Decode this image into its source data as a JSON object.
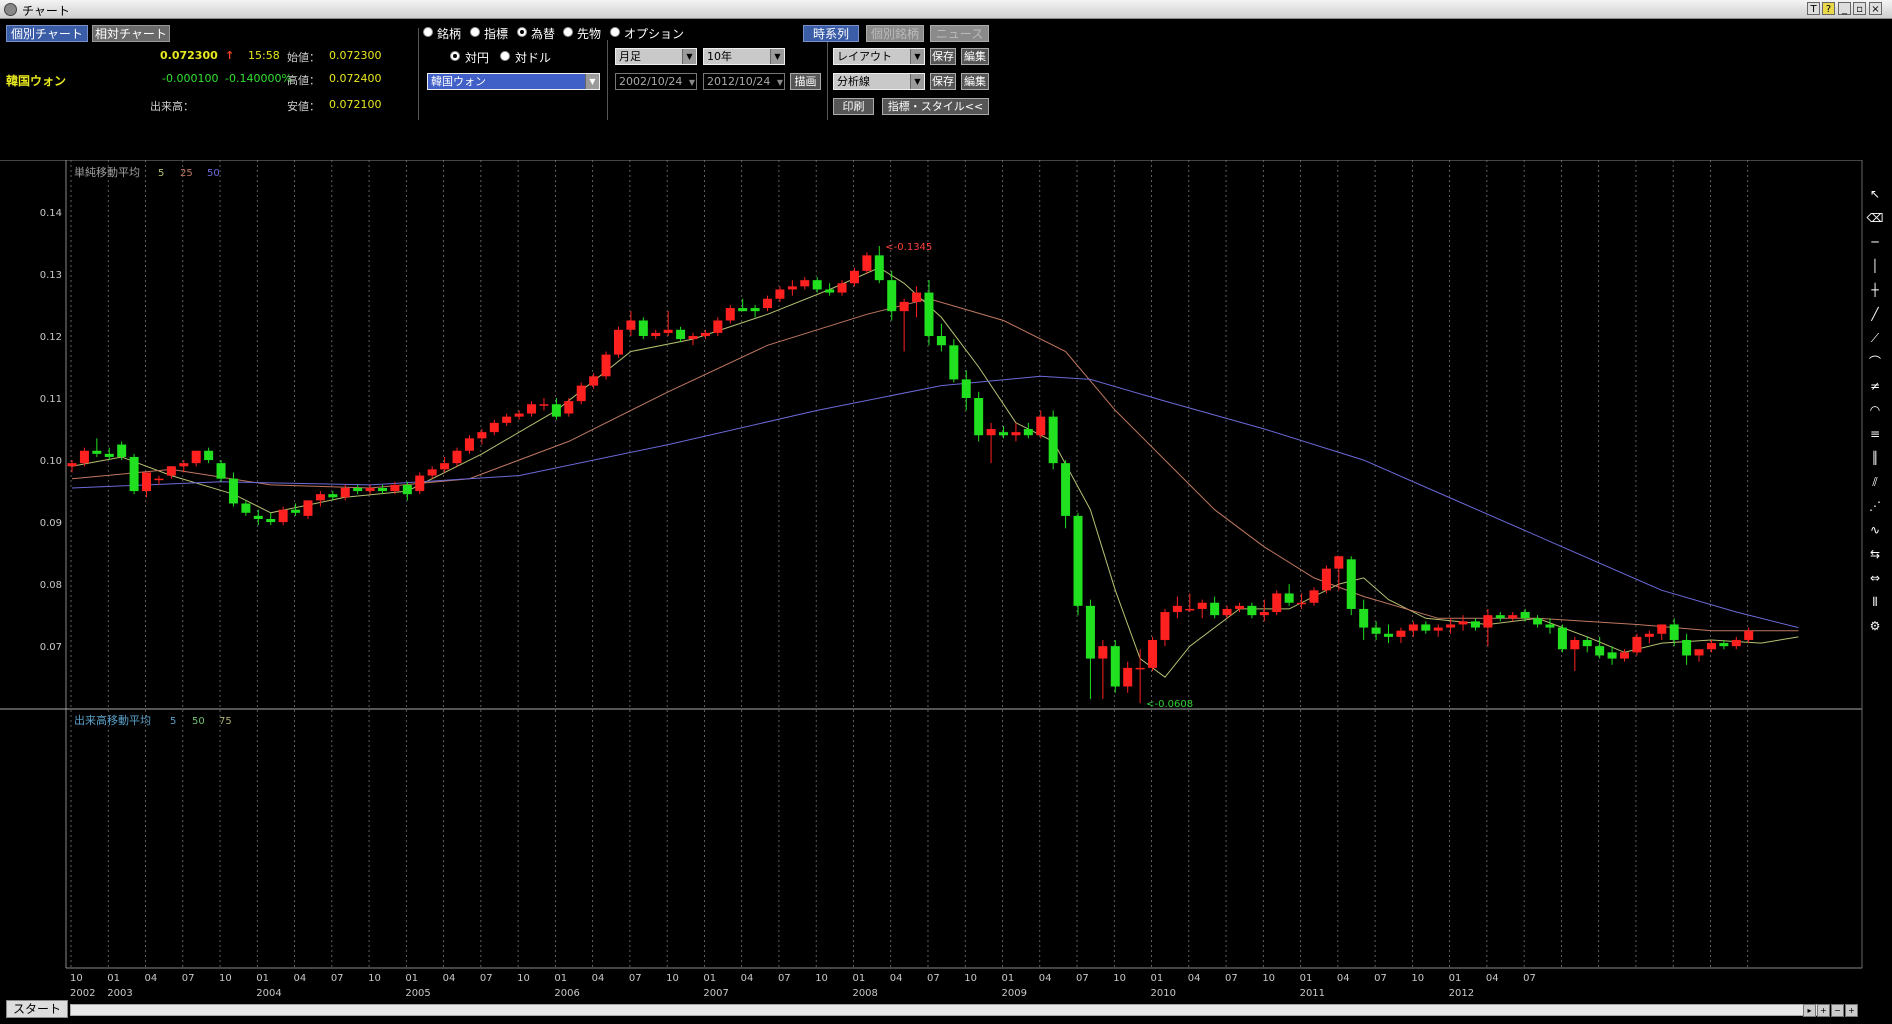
{
  "window": {
    "title": "チャート"
  },
  "tabs": {
    "individual": "個別チャート",
    "relative": "相対チャート"
  },
  "quote": {
    "name": "韓国ウォン",
    "price": "0.072300",
    "arrow": "↑",
    "time": "15:58",
    "change": "-0.000100",
    "change_pct": "-0.140000%",
    "volume_label": "出来高：",
    "open_label": "始値：",
    "open": "0.072300",
    "high_label": "高値：",
    "high": "0.072400",
    "low_label": "安値：",
    "low": "0.072100"
  },
  "asset_types": [
    "銘柄",
    "指標",
    "為替",
    "先物",
    "オプション"
  ],
  "asset_type_selected": 2,
  "fx_base": {
    "yen": "対円",
    "dollar": "対ドル",
    "selected": 0
  },
  "symbol_select": "韓国ウォン",
  "period": {
    "interval": "月足",
    "range": "10年",
    "start": "2002/10/24",
    "end": "2012/10/24",
    "draw": "描画"
  },
  "toolbar": {
    "timeseries": "時系列",
    "individual_stock": "個別銘柄",
    "news": "ニュース",
    "layout": "レイアウト",
    "analysis": "分析線",
    "save": "保存",
    "edit": "編集",
    "print": "印刷",
    "indicator_style": "指標・スタイル<<"
  },
  "price_panel": {
    "legend_title": "単純移動平均",
    "ma_periods": [
      "5",
      "25",
      "50"
    ],
    "ma_colors": [
      "#b8c070",
      "#c07860",
      "#6a6ad8"
    ]
  },
  "volume_panel": {
    "legend_title": "出来高移動平均",
    "ma_periods": [
      "5",
      "50",
      "75"
    ],
    "ma_colors": [
      "#5aa0c8",
      "#70c070",
      "#b0b070"
    ]
  },
  "colors": {
    "up": "#ff2020",
    "down": "#20e020",
    "background": "#000000",
    "grid": "#777777"
  },
  "chart_data": {
    "type": "candlestick",
    "interval": "monthly",
    "y_ticks": [
      "0.14",
      "0.13",
      "0.12",
      "0.11",
      "0.10",
      "0.09",
      "0.08",
      "0.07"
    ],
    "ylim": [
      0.061,
      0.1445
    ],
    "annotations": {
      "high": "<-0.1345",
      "low": "<-0.0608",
      "high_value": 0.1345,
      "low_value": 0.0608
    },
    "x_month_labels": [
      "10",
      "01",
      "04",
      "07",
      "10",
      "01",
      "04",
      "07",
      "10",
      "01",
      "04",
      "07",
      "10",
      "01",
      "04",
      "07",
      "10",
      "01",
      "04",
      "07",
      "10",
      "01",
      "04",
      "07",
      "10",
      "01",
      "04",
      "07",
      "10",
      "01",
      "04",
      "07",
      "10",
      "01",
      "04",
      "07",
      "10",
      "01",
      "04",
      "07"
    ],
    "x_year_labels": [
      "2002",
      "2003",
      "2004",
      "2005",
      "2006",
      "2007",
      "2008",
      "2009",
      "2010",
      "2011",
      "2012"
    ],
    "candles": [
      [
        0.099,
        0.1,
        0.098,
        0.0995
      ],
      [
        0.0995,
        0.102,
        0.099,
        0.1015
      ],
      [
        0.1015,
        0.1035,
        0.1005,
        0.101
      ],
      [
        0.101,
        0.102,
        0.1,
        0.1005
      ],
      [
        0.1025,
        0.103,
        0.1,
        0.1005
      ],
      [
        0.1005,
        0.101,
        0.0945,
        0.095
      ],
      [
        0.095,
        0.098,
        0.094,
        0.098
      ],
      [
        0.097,
        0.0975,
        0.096,
        0.097
      ],
      [
        0.0975,
        0.099,
        0.097,
        0.099
      ],
      [
        0.099,
        0.1,
        0.098,
        0.0995
      ],
      [
        0.0995,
        0.1015,
        0.099,
        0.1015
      ],
      [
        0.1015,
        0.102,
        0.0995,
        0.1
      ],
      [
        0.0995,
        0.1,
        0.0965,
        0.097
      ],
      [
        0.097,
        0.098,
        0.0925,
        0.093
      ],
      [
        0.093,
        0.0935,
        0.091,
        0.0915
      ],
      [
        0.091,
        0.092,
        0.0895,
        0.0905
      ],
      [
        0.0905,
        0.0915,
        0.0895,
        0.09
      ],
      [
        0.09,
        0.0925,
        0.0895,
        0.092
      ],
      [
        0.092,
        0.093,
        0.091,
        0.0915
      ],
      [
        0.091,
        0.0935,
        0.0905,
        0.0935
      ],
      [
        0.0935,
        0.095,
        0.0925,
        0.0945
      ],
      [
        0.0945,
        0.095,
        0.0935,
        0.094
      ],
      [
        0.094,
        0.096,
        0.0935,
        0.0955
      ],
      [
        0.0955,
        0.096,
        0.0945,
        0.095
      ],
      [
        0.095,
        0.096,
        0.0945,
        0.0955
      ],
      [
        0.0955,
        0.096,
        0.0945,
        0.095
      ],
      [
        0.095,
        0.0965,
        0.0945,
        0.096
      ],
      [
        0.096,
        0.0965,
        0.0935,
        0.0945
      ],
      [
        0.095,
        0.098,
        0.0945,
        0.0975
      ],
      [
        0.0975,
        0.099,
        0.097,
        0.0985
      ],
      [
        0.0985,
        0.1005,
        0.098,
        0.0995
      ],
      [
        0.0995,
        0.102,
        0.099,
        0.1015
      ],
      [
        0.1015,
        0.104,
        0.101,
        0.1035
      ],
      [
        0.1035,
        0.105,
        0.1025,
        0.1045
      ],
      [
        0.1045,
        0.1065,
        0.104,
        0.106
      ],
      [
        0.106,
        0.1075,
        0.1055,
        0.107
      ],
      [
        0.107,
        0.108,
        0.1065,
        0.1075
      ],
      [
        0.1075,
        0.1095,
        0.107,
        0.109
      ],
      [
        0.109,
        0.11,
        0.108,
        0.109
      ],
      [
        0.109,
        0.11,
        0.1065,
        0.107
      ],
      [
        0.1075,
        0.11,
        0.107,
        0.1095
      ],
      [
        0.1095,
        0.1125,
        0.109,
        0.112
      ],
      [
        0.112,
        0.114,
        0.1115,
        0.1135
      ],
      [
        0.1135,
        0.1175,
        0.113,
        0.117
      ],
      [
        0.117,
        0.1215,
        0.1165,
        0.121
      ],
      [
        0.121,
        0.124,
        0.12,
        0.1225
      ],
      [
        0.1225,
        0.123,
        0.1195,
        0.12
      ],
      [
        0.12,
        0.121,
        0.1195,
        0.1205
      ],
      [
        0.1205,
        0.124,
        0.12,
        0.121
      ],
      [
        0.121,
        0.1215,
        0.119,
        0.1195
      ],
      [
        0.1195,
        0.1205,
        0.1185,
        0.12
      ],
      [
        0.12,
        0.121,
        0.1195,
        0.1205
      ],
      [
        0.1205,
        0.123,
        0.12,
        0.1225
      ],
      [
        0.1225,
        0.125,
        0.122,
        0.1245
      ],
      [
        0.1245,
        0.126,
        0.124,
        0.124
      ],
      [
        0.1245,
        0.125,
        0.123,
        0.124
      ],
      [
        0.1245,
        0.1265,
        0.124,
        0.126
      ],
      [
        0.126,
        0.128,
        0.1255,
        0.1275
      ],
      [
        0.1275,
        0.129,
        0.1265,
        0.128
      ],
      [
        0.128,
        0.1295,
        0.1275,
        0.129
      ],
      [
        0.129,
        0.1295,
        0.127,
        0.1275
      ],
      [
        0.1275,
        0.1285,
        0.1265,
        0.127
      ],
      [
        0.127,
        0.129,
        0.1265,
        0.1285
      ],
      [
        0.1285,
        0.131,
        0.128,
        0.1305
      ],
      [
        0.1305,
        0.1335,
        0.13,
        0.133
      ],
      [
        0.133,
        0.1345,
        0.1285,
        0.129
      ],
      [
        0.129,
        0.1305,
        0.1225,
        0.124
      ],
      [
        0.124,
        0.126,
        0.1175,
        0.1255
      ],
      [
        0.1255,
        0.128,
        0.123,
        0.127
      ],
      [
        0.127,
        0.129,
        0.1185,
        0.12
      ],
      [
        0.12,
        0.122,
        0.1175,
        0.1185
      ],
      [
        0.1185,
        0.1195,
        0.1125,
        0.113
      ],
      [
        0.113,
        0.1145,
        0.108,
        0.11
      ],
      [
        0.11,
        0.111,
        0.103,
        0.104
      ],
      [
        0.104,
        0.106,
        0.0995,
        0.105
      ],
      [
        0.1045,
        0.1055,
        0.1035,
        0.104
      ],
      [
        0.104,
        0.106,
        0.103,
        0.1045
      ],
      [
        0.105,
        0.106,
        0.1035,
        0.104
      ],
      [
        0.104,
        0.108,
        0.1035,
        0.107
      ],
      [
        0.107,
        0.108,
        0.0985,
        0.0995
      ],
      [
        0.0995,
        0.1,
        0.089,
        0.091
      ],
      [
        0.091,
        0.0915,
        0.075,
        0.0765
      ],
      [
        0.0765,
        0.0775,
        0.0615,
        0.068
      ],
      [
        0.068,
        0.071,
        0.0615,
        0.07
      ],
      [
        0.07,
        0.071,
        0.0625,
        0.0635
      ],
      [
        0.0635,
        0.0675,
        0.0625,
        0.0665
      ],
      [
        0.0665,
        0.0695,
        0.0608,
        0.0665
      ],
      [
        0.0665,
        0.0715,
        0.066,
        0.071
      ],
      [
        0.071,
        0.076,
        0.07,
        0.0755
      ],
      [
        0.0755,
        0.078,
        0.0745,
        0.0765
      ],
      [
        0.076,
        0.0785,
        0.0755,
        0.076
      ],
      [
        0.076,
        0.0775,
        0.0745,
        0.077
      ],
      [
        0.077,
        0.078,
        0.0745,
        0.075
      ],
      [
        0.075,
        0.0765,
        0.0745,
        0.076
      ],
      [
        0.076,
        0.077,
        0.0755,
        0.0765
      ],
      [
        0.0765,
        0.077,
        0.0745,
        0.075
      ],
      [
        0.075,
        0.0775,
        0.074,
        0.0755
      ],
      [
        0.0755,
        0.079,
        0.075,
        0.0785
      ],
      [
        0.0785,
        0.08,
        0.0765,
        0.077
      ],
      [
        0.077,
        0.0785,
        0.076,
        0.077
      ],
      [
        0.077,
        0.0795,
        0.0765,
        0.079
      ],
      [
        0.079,
        0.083,
        0.0785,
        0.0825
      ],
      [
        0.0825,
        0.0845,
        0.079,
        0.0845
      ],
      [
        0.084,
        0.0845,
        0.075,
        0.076
      ],
      [
        0.076,
        0.0775,
        0.071,
        0.073
      ],
      [
        0.073,
        0.074,
        0.071,
        0.072
      ],
      [
        0.072,
        0.0735,
        0.0705,
        0.0715
      ],
      [
        0.0715,
        0.073,
        0.0705,
        0.0725
      ],
      [
        0.0725,
        0.074,
        0.0715,
        0.0735
      ],
      [
        0.0735,
        0.074,
        0.072,
        0.0725
      ],
      [
        0.0725,
        0.0735,
        0.0715,
        0.073
      ],
      [
        0.073,
        0.0745,
        0.072,
        0.0735
      ],
      [
        0.0735,
        0.075,
        0.0725,
        0.074
      ],
      [
        0.074,
        0.0745,
        0.0725,
        0.073
      ],
      [
        0.073,
        0.076,
        0.07,
        0.075
      ],
      [
        0.075,
        0.0755,
        0.074,
        0.0745
      ],
      [
        0.0745,
        0.0755,
        0.074,
        0.075
      ],
      [
        0.0755,
        0.076,
        0.074,
        0.0745
      ],
      [
        0.0745,
        0.075,
        0.073,
        0.0735
      ],
      [
        0.0735,
        0.0745,
        0.072,
        0.073
      ],
      [
        0.073,
        0.0735,
        0.069,
        0.0695
      ],
      [
        0.0695,
        0.0715,
        0.066,
        0.071
      ],
      [
        0.071,
        0.0715,
        0.069,
        0.07
      ],
      [
        0.07,
        0.0715,
        0.068,
        0.0685
      ],
      [
        0.069,
        0.07,
        0.067,
        0.068
      ],
      [
        0.068,
        0.0695,
        0.0675,
        0.069
      ],
      [
        0.069,
        0.072,
        0.0685,
        0.0715
      ],
      [
        0.0715,
        0.0725,
        0.0705,
        0.072
      ],
      [
        0.072,
        0.0735,
        0.071,
        0.0735
      ],
      [
        0.0735,
        0.0745,
        0.07,
        0.071
      ],
      [
        0.071,
        0.072,
        0.067,
        0.0685
      ],
      [
        0.0685,
        0.0695,
        0.0675,
        0.0695
      ],
      [
        0.0695,
        0.071,
        0.069,
        0.0705
      ],
      [
        0.0705,
        0.071,
        0.0695,
        0.07
      ],
      [
        0.07,
        0.0715,
        0.0695,
        0.071
      ],
      [
        0.071,
        0.073,
        0.0705,
        0.0725
      ]
    ],
    "ma5_points": [
      [
        0,
        0.099
      ],
      [
        4,
        0.1005
      ],
      [
        8,
        0.0975
      ],
      [
        13,
        0.0945
      ],
      [
        16,
        0.0915
      ],
      [
        22,
        0.094
      ],
      [
        27,
        0.095
      ],
      [
        33,
        0.101
      ],
      [
        39,
        0.108
      ],
      [
        45,
        0.1175
      ],
      [
        50,
        0.1195
      ],
      [
        56,
        0.1235
      ],
      [
        61,
        0.1275
      ],
      [
        65,
        0.131
      ],
      [
        67,
        0.1285
      ],
      [
        70,
        0.123
      ],
      [
        73,
        0.115
      ],
      [
        76,
        0.106
      ],
      [
        79,
        0.103
      ],
      [
        82,
        0.092
      ],
      [
        84,
        0.079
      ],
      [
        86,
        0.068
      ],
      [
        88,
        0.065
      ],
      [
        90,
        0.07
      ],
      [
        94,
        0.076
      ],
      [
        98,
        0.076
      ],
      [
        102,
        0.08
      ],
      [
        104,
        0.081
      ],
      [
        106,
        0.0775
      ],
      [
        109,
        0.0745
      ],
      [
        114,
        0.0735
      ],
      [
        118,
        0.0745
      ],
      [
        122,
        0.0715
      ],
      [
        125,
        0.069
      ],
      [
        128,
        0.0705
      ],
      [
        132,
        0.071
      ],
      [
        136,
        0.0705
      ],
      [
        139,
        0.0715
      ]
    ],
    "ma25_points": [
      [
        0,
        0.097
      ],
      [
        8,
        0.0985
      ],
      [
        16,
        0.096
      ],
      [
        24,
        0.0955
      ],
      [
        32,
        0.097
      ],
      [
        40,
        0.103
      ],
      [
        48,
        0.111
      ],
      [
        56,
        0.1185
      ],
      [
        64,
        0.1235
      ],
      [
        69,
        0.126
      ],
      [
        75,
        0.1225
      ],
      [
        80,
        0.1175
      ],
      [
        84,
        0.108
      ],
      [
        88,
        0.1
      ],
      [
        92,
        0.092
      ],
      [
        96,
        0.086
      ],
      [
        100,
        0.081
      ],
      [
        104,
        0.078
      ],
      [
        110,
        0.0745
      ],
      [
        118,
        0.0745
      ],
      [
        126,
        0.0735
      ],
      [
        132,
        0.0725
      ],
      [
        139,
        0.0725
      ]
    ],
    "ma50_points": [
      [
        0,
        0.0955
      ],
      [
        12,
        0.0965
      ],
      [
        24,
        0.096
      ],
      [
        36,
        0.0975
      ],
      [
        48,
        0.1025
      ],
      [
        60,
        0.108
      ],
      [
        70,
        0.112
      ],
      [
        78,
        0.1135
      ],
      [
        82,
        0.113
      ],
      [
        88,
        0.1095
      ],
      [
        96,
        0.105
      ],
      [
        104,
        0.1
      ],
      [
        112,
        0.093
      ],
      [
        120,
        0.086
      ],
      [
        128,
        0.079
      ],
      [
        134,
        0.0755
      ],
      [
        139,
        0.073
      ]
    ]
  }
}
